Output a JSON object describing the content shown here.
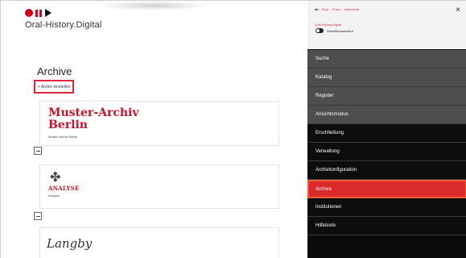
{
  "brand": "Oral-History.Digital",
  "main": {
    "heading": "Archive",
    "add_button": "+ Archiv einstellen",
    "archives": [
      {
        "title_line1": "Muster-Archiv",
        "title_line2": "Berlin",
        "subtitle": "Muster-Archiv Berlin"
      },
      {
        "logo_text": "ANALYSE",
        "subtitle": "Analyse"
      },
      {
        "signature": "Langby"
      }
    ]
  },
  "panel": {
    "languages": [
      "de",
      "Engl.",
      "Franz.",
      "Italienisch"
    ],
    "close": "×",
    "highlight_label": "Oral-History.Digital",
    "switch_label": "Redaktionsansicht",
    "menu": [
      {
        "label": "Suche",
        "style": "grey"
      },
      {
        "label": "Katalog",
        "style": "grey"
      },
      {
        "label": "Register",
        "style": "grey"
      },
      {
        "label": "Ansichtsmodus",
        "style": "grey"
      },
      {
        "label": "Erschließung",
        "style": "dark"
      },
      {
        "label": "Verwaltung",
        "style": "dark"
      },
      {
        "label": "Archivkonfiguration",
        "style": "dark"
      },
      {
        "label": "Archive",
        "style": "active"
      },
      {
        "label": "Institutionen",
        "style": "dark"
      },
      {
        "label": "Hilfetexte",
        "style": "dark"
      }
    ]
  },
  "colors": {
    "accent_red": "#d92a2c",
    "brand_red": "#c9122b",
    "panel_grey": "#4e4e4c",
    "panel_dark": "#0d0d0d"
  },
  "icons": {
    "logo": "record-pause-play-icon",
    "close": "close-icon",
    "collapse": "minus-square-icon"
  }
}
